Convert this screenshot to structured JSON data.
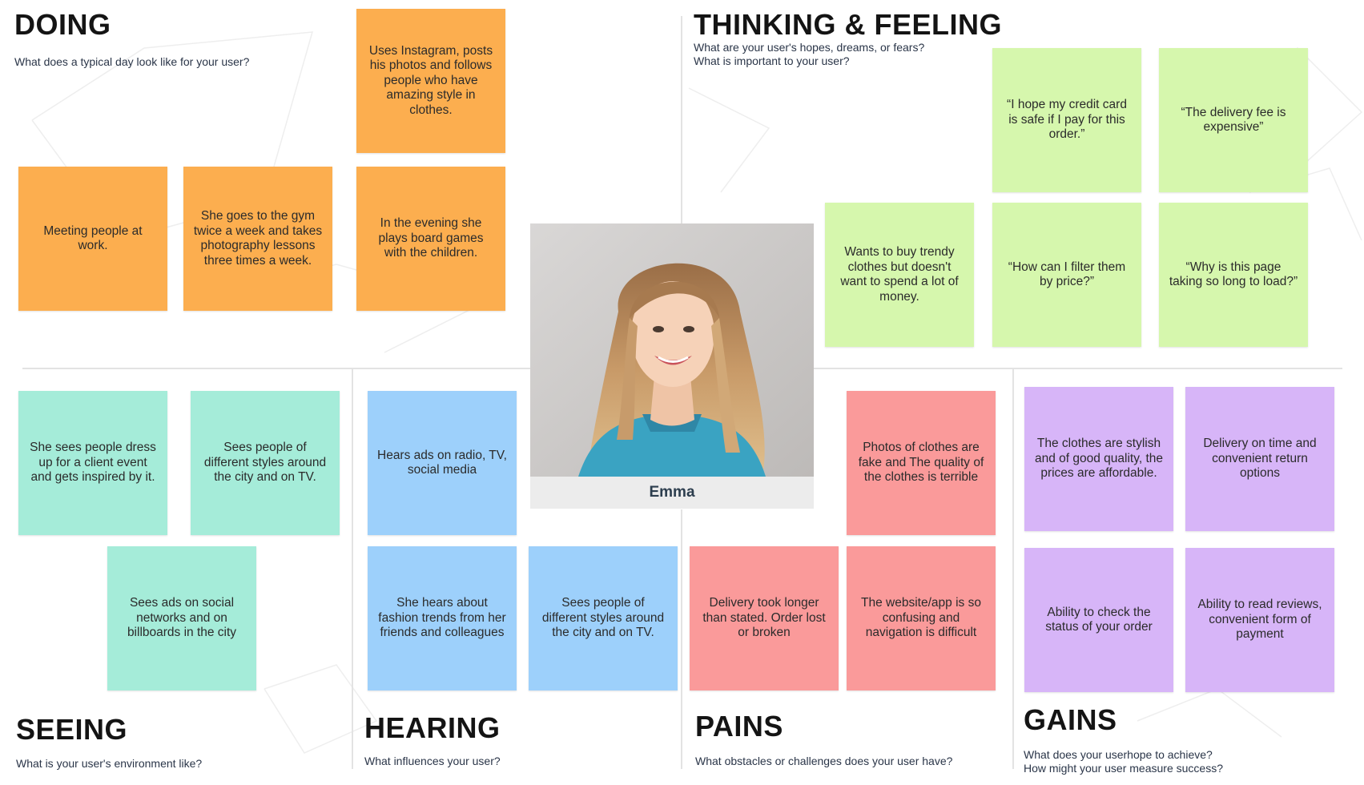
{
  "colors": {
    "orange": "#fcae4f",
    "green": "#d6f7ad",
    "teal": "#a5ecd9",
    "blue": "#9dd0fb",
    "red": "#fa9a9a",
    "purple": "#d7b5f8"
  },
  "persona": {
    "name": "Emma",
    "image": "portrait-photo"
  },
  "sections": {
    "doing": {
      "title": "DOING",
      "subtitle": "What does a typical day look like for your user?",
      "notes": [
        "Uses Instagram, posts his photos and follows people who have amazing style in clothes.",
        "Meeting people at work.",
        "She goes to the gym twice a week and takes photography lessons three times a week.",
        "In the evening she plays board games with the children."
      ]
    },
    "thinking": {
      "title": "THINKING & FEELING",
      "subtitle": "What are your user's hopes, dreams, or fears?",
      "subtitle2": "What is important to your user?",
      "notes": [
        "“I hope my credit card is safe if I pay for this order.”",
        "“The delivery fee is expensive”",
        "Wants to buy trendy clothes but doesn't want to spend a lot of money.",
        "“How can I filter them by price?”",
        "“Why is this page taking so long to load?”"
      ]
    },
    "seeing": {
      "title": "SEEING",
      "subtitle": "What is your user's environment like?",
      "notes": [
        "She sees people dress up for a client event and gets inspired by it.",
        "Sees people of different styles around the city and on TV.",
        "Sees ads on social networks and on billboards in the city"
      ]
    },
    "hearing": {
      "title": "HEARING",
      "subtitle": "What influences your user?",
      "notes": [
        "Hears ads on radio, TV, social media",
        "She hears about fashion trends from her friends and colleagues",
        "Sees people of different styles around the city and on TV."
      ]
    },
    "pains": {
      "title": "PAINS",
      "subtitle": "What obstacles or challenges does your user have?",
      "notes": [
        "Photos of clothes are fake and The quality of the clothes is terrible",
        "Delivery took longer than stated. Order lost or broken",
        "The website/app is so confusing and navigation is difficult"
      ]
    },
    "gains": {
      "title": "GAINS",
      "subtitle": "What does your userhope to achieve?",
      "subtitle2": "How might your user measure success?",
      "notes": [
        "The clothes are stylish and of good quality, the prices are affordable.",
        "Delivery on time and convenient return options",
        "Ability to check the status of your order",
        "Ability to read reviews, convenient form of payment"
      ]
    }
  }
}
